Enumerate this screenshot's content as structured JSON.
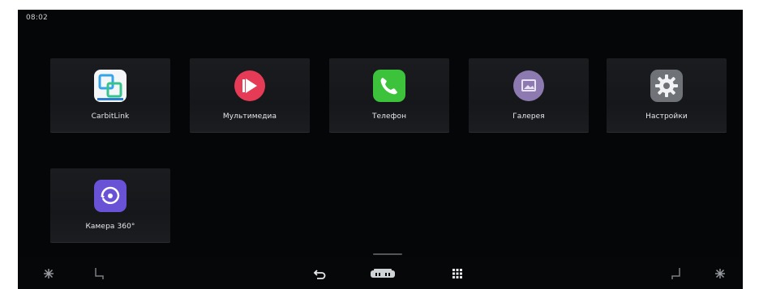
{
  "status": {
    "time": "08:02"
  },
  "apps": [
    {
      "label": "CarbitLink",
      "icon": "carbitlink-icon"
    },
    {
      "label": "Мультимедиа",
      "icon": "multimedia-icon"
    },
    {
      "label": "Телефон",
      "icon": "phone-icon"
    },
    {
      "label": "Галерея",
      "icon": "gallery-icon"
    },
    {
      "label": "Настройки",
      "icon": "settings-icon"
    },
    {
      "label": "Камера 360°",
      "icon": "camera-360-icon"
    }
  ],
  "dock": {
    "left": [
      "climate-left-icon",
      "seat-left-icon"
    ],
    "center": [
      "back-icon",
      "car-home-icon",
      "app-grid-icon"
    ],
    "right": [
      "seat-right-icon",
      "climate-right-icon"
    ]
  },
  "colors": {
    "background": "#050607",
    "phone_green": "#3cc23b",
    "multimedia_red": "#e83a55",
    "gallery_purple": "#8d7ab0",
    "camera_purple": "#6a52d6",
    "settings_gray": "#6f7377"
  }
}
